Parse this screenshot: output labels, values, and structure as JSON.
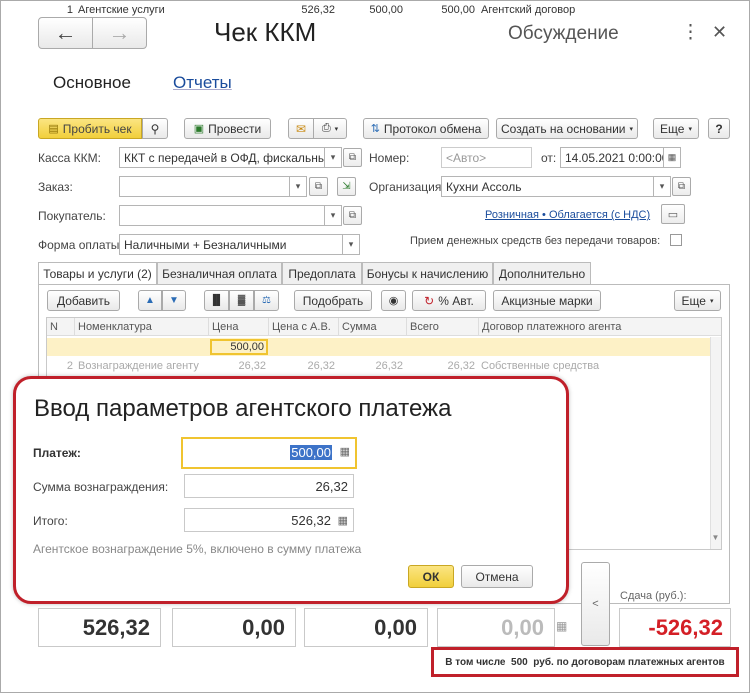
{
  "window": {
    "title": "Чек ККМ",
    "discussion": "Обсуждение"
  },
  "nav": {
    "main": "Основное",
    "reports": "Отчеты"
  },
  "toolbar": {
    "punch": "Пробить чек",
    "post": "Провести",
    "exchange_log": "Протокол обмена",
    "create_based": "Создать на основании",
    "more": "Еще",
    "help": "?"
  },
  "form": {
    "kassa_label": "Касса ККМ:",
    "kassa_value": "ККТ с передачей в ОФД, фискальный р",
    "order_label": "Заказ:",
    "order_value": "",
    "buyer_label": "Покупатель:",
    "buyer_value": "",
    "payform_label": "Форма оплаты:",
    "payform_value": "Наличными + Безналичными",
    "number_label": "Номер:",
    "number_placeholder": "<Авто>",
    "from_label": "от:",
    "date_value": "14.05.2021  0:00:00",
    "org_label": "Организация:",
    "org_value": "Кухни Ассоль",
    "tax_link": "Розничная • Облагается (с НДС)",
    "no_goods_label": "Прием денежных средств без передачи товаров:"
  },
  "tabs": [
    {
      "label": "Товары и услуги (2)"
    },
    {
      "label": "Безналичная оплата"
    },
    {
      "label": "Предоплата"
    },
    {
      "label": "Бонусы к начислению"
    },
    {
      "label": "Дополнительно"
    }
  ],
  "table_toolbar": {
    "add": "Добавить",
    "select": "Подобрать",
    "auto_pct": "% Авт.",
    "excise": "Акцизные марки",
    "more": "Еще"
  },
  "table": {
    "headers": [
      "N",
      "Номенклатура",
      "Цена",
      "Цена с А.В.",
      "Сумма",
      "Всего",
      "Договор платежного агента"
    ],
    "rows": [
      {
        "n": "1",
        "name": "Агентские услуги",
        "price": "500,00",
        "price_av": "526,32",
        "sum": "500,00",
        "total": "500,00",
        "contract": "Агентский договор"
      },
      {
        "n": "2",
        "name": "Вознаграждение агенту",
        "price": "26,32",
        "price_av": "26,32",
        "sum": "26,32",
        "total": "26,32",
        "contract": "Собственные средства"
      }
    ]
  },
  "dialog": {
    "title": "Ввод параметров агентского платежа",
    "payment_label": "Платеж:",
    "payment_value": "500,00",
    "reward_label": "Сумма вознаграждения:",
    "reward_value": "26,32",
    "total_label": "Итого:",
    "total_value": "526,32",
    "note": "Агентское вознаграждение 5%, включено в сумму платежа",
    "ok": "ОК",
    "cancel": "Отмена"
  },
  "summary": {
    "total": "526,32",
    "cash": "0,00",
    "card": "0,00",
    "other": "0,00",
    "change_label": "Сдача (руб.):",
    "change_value": "-526,32",
    "collapse": "<",
    "agent_note": "В том числе  500  руб. по договорам платежных агентов"
  },
  "colors": {
    "accent_red": "#c0202a",
    "link_blue": "#1a4c9c",
    "yellow_btn": "#f5d84a",
    "row_highlight": "#fdf1c6"
  }
}
